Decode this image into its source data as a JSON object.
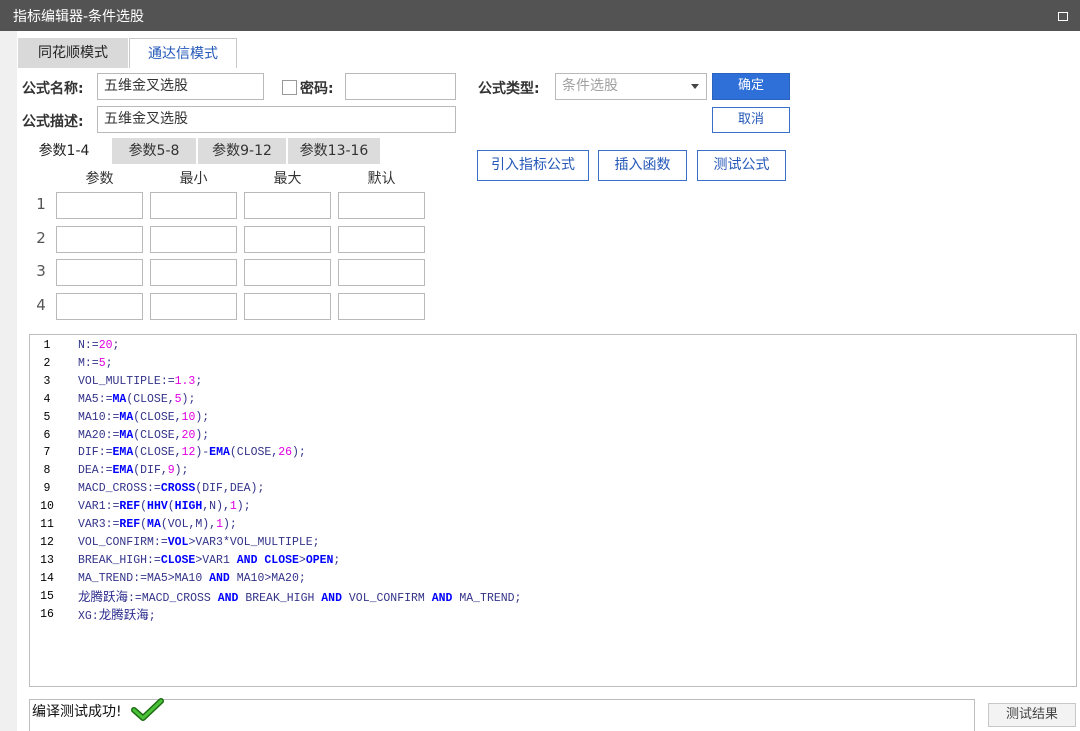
{
  "window": {
    "title": "指标编辑器-条件选股"
  },
  "mode_tabs": [
    "同花顺模式",
    "通达信模式"
  ],
  "form": {
    "name_label": "公式名称:",
    "name_value": "五维金叉选股",
    "password_label": "密码:",
    "password_value": "",
    "type_label": "公式类型:",
    "type_value": "条件选股",
    "desc_label": "公式描述:",
    "desc_value": "五维金叉选股"
  },
  "buttons": {
    "confirm": "确定",
    "cancel": "取消",
    "import": "引入指标公式",
    "insert": "插入函数",
    "test": "测试公式",
    "result": "测试结果"
  },
  "param_tabs": [
    "参数1-4",
    "参数5-8",
    "参数9-12",
    "参数13-16"
  ],
  "param_headers": [
    "参数",
    "最小",
    "最大",
    "默认"
  ],
  "param_rows": [
    "1",
    "2",
    "3",
    "4"
  ],
  "code_lines": [
    {
      "n": "1",
      "tokens": [
        [
          "p",
          "N:="
        ],
        [
          "n",
          "20"
        ],
        [
          "p",
          ";"
        ]
      ]
    },
    {
      "n": "2",
      "tokens": [
        [
          "p",
          "M:="
        ],
        [
          "n",
          "5"
        ],
        [
          "p",
          ";"
        ]
      ]
    },
    {
      "n": "3",
      "tokens": [
        [
          "p",
          "VOL_MULTIPLE:="
        ],
        [
          "n",
          "1.3"
        ],
        [
          "p",
          ";"
        ]
      ]
    },
    {
      "n": "4",
      "tokens": [
        [
          "p",
          "MA5:="
        ],
        [
          "k",
          "MA"
        ],
        [
          "p",
          "(CLOSE,"
        ],
        [
          "n",
          "5"
        ],
        [
          "p",
          ");"
        ]
      ]
    },
    {
      "n": "5",
      "tokens": [
        [
          "p",
          "MA10:="
        ],
        [
          "k",
          "MA"
        ],
        [
          "p",
          "(CLOSE,"
        ],
        [
          "n",
          "10"
        ],
        [
          "p",
          ");"
        ]
      ]
    },
    {
      "n": "6",
      "tokens": [
        [
          "p",
          "MA20:="
        ],
        [
          "k",
          "MA"
        ],
        [
          "p",
          "(CLOSE,"
        ],
        [
          "n",
          "20"
        ],
        [
          "p",
          ");"
        ]
      ]
    },
    {
      "n": "7",
      "tokens": [
        [
          "p",
          "DIF:="
        ],
        [
          "k",
          "EMA"
        ],
        [
          "p",
          "(CLOSE,"
        ],
        [
          "n",
          "12"
        ],
        [
          "p",
          ")-"
        ],
        [
          "k",
          "EMA"
        ],
        [
          "p",
          "(CLOSE,"
        ],
        [
          "n",
          "26"
        ],
        [
          "p",
          ");"
        ]
      ]
    },
    {
      "n": "8",
      "tokens": [
        [
          "p",
          "DEA:="
        ],
        [
          "k",
          "EMA"
        ],
        [
          "p",
          "(DIF,"
        ],
        [
          "n",
          "9"
        ],
        [
          "p",
          ");"
        ]
      ]
    },
    {
      "n": "9",
      "tokens": [
        [
          "p",
          "MACD_CROSS:="
        ],
        [
          "k",
          "CROSS"
        ],
        [
          "p",
          "(DIF,DEA);"
        ]
      ]
    },
    {
      "n": "10",
      "tokens": [
        [
          "p",
          "VAR1:="
        ],
        [
          "k",
          "REF"
        ],
        [
          "p",
          "("
        ],
        [
          "k",
          "HHV"
        ],
        [
          "p",
          "("
        ],
        [
          "k",
          "HIGH"
        ],
        [
          "p",
          ",N),"
        ],
        [
          "n",
          "1"
        ],
        [
          "p",
          ");"
        ]
      ]
    },
    {
      "n": "11",
      "tokens": [
        [
          "p",
          "VAR3:="
        ],
        [
          "k",
          "REF"
        ],
        [
          "p",
          "("
        ],
        [
          "k",
          "MA"
        ],
        [
          "p",
          "(VOL,M),"
        ],
        [
          "n",
          "1"
        ],
        [
          "p",
          ");"
        ]
      ]
    },
    {
      "n": "12",
      "tokens": [
        [
          "p",
          "VOL_CONFIRM:="
        ],
        [
          "k",
          "VOL"
        ],
        [
          "p",
          ">VAR3*VOL_MULTIPLE;"
        ]
      ]
    },
    {
      "n": "13",
      "tokens": [
        [
          "p",
          "BREAK_HIGH:="
        ],
        [
          "k",
          "CLOSE"
        ],
        [
          "p",
          ">VAR1 "
        ],
        [
          "k",
          "AND"
        ],
        [
          "p",
          " "
        ],
        [
          "k",
          "CLOSE"
        ],
        [
          "p",
          ">"
        ],
        [
          "k",
          "OPEN"
        ],
        [
          "p",
          ";"
        ]
      ]
    },
    {
      "n": "14",
      "tokens": [
        [
          "p",
          "MA_TREND:=MA5>MA10 "
        ],
        [
          "k",
          "AND"
        ],
        [
          "p",
          " MA10>MA20;"
        ]
      ]
    },
    {
      "n": "15",
      "tokens": [
        [
          "c",
          "龙腾跃海"
        ],
        [
          "p",
          ":=MACD_CROSS "
        ],
        [
          "k",
          "AND"
        ],
        [
          "p",
          " BREAK_HIGH "
        ],
        [
          "k",
          "AND"
        ],
        [
          "p",
          " VOL_CONFIRM "
        ],
        [
          "k",
          "AND"
        ],
        [
          "p",
          " MA_TREND;"
        ]
      ]
    },
    {
      "n": "16",
      "tokens": [
        [
          "p",
          "XG:"
        ],
        [
          "c",
          "龙腾跃海"
        ],
        [
          "p",
          ";"
        ]
      ]
    }
  ],
  "status": {
    "message": "编译测试成功!"
  },
  "icons": {
    "maximize": "maximize-icon",
    "success": "checkmark-icon",
    "dropdown": "chevron-down-icon"
  },
  "colors": {
    "accent": "#2e6fd8",
    "keyword": "#0000ff",
    "number": "#e000e0",
    "check": "#2e9a1e"
  }
}
